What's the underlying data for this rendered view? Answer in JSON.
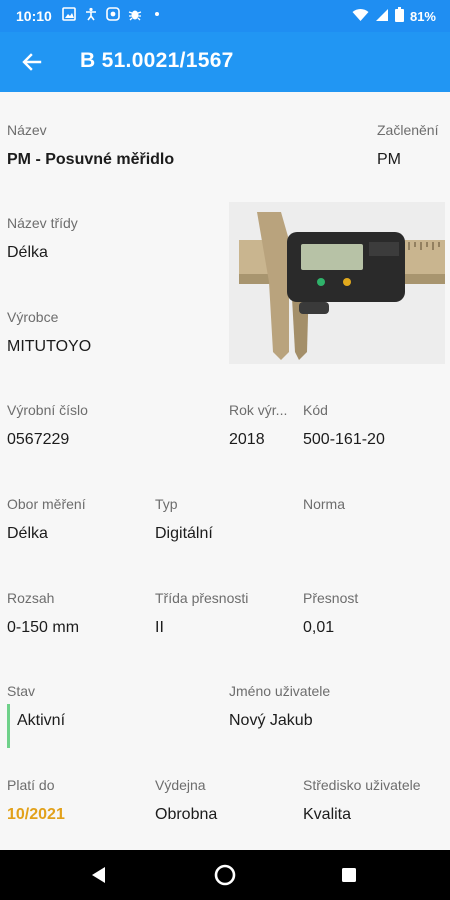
{
  "status": {
    "time": "10:10",
    "battery": "81%",
    "icons": [
      "image-icon",
      "accessibility-icon",
      "app-icon",
      "bug-icon",
      "dot-icon"
    ]
  },
  "appbar": {
    "title": "B 51.0021/1567",
    "back_icon": "arrow-left-icon"
  },
  "fields": {
    "nazev": {
      "label": "Název",
      "value": "PM - Posuvné měřidlo"
    },
    "zacleneni": {
      "label": "Začlenění",
      "value": "PM"
    },
    "nazev_tridy": {
      "label": "Název třídy",
      "value": "Délka"
    },
    "vyrobce": {
      "label": "Výrobce",
      "value": "MITUTOYO"
    },
    "vyrobni_cislo": {
      "label": "Výrobní číslo",
      "value": "0567229"
    },
    "rok_vyroby": {
      "label": "Rok výr...",
      "value": "2018"
    },
    "kod": {
      "label": "Kód",
      "value": "500-161-20"
    },
    "obor_mereni": {
      "label": "Obor měření",
      "value": "Délka"
    },
    "typ": {
      "label": "Typ",
      "value": "Digitální"
    },
    "norma": {
      "label": "Norma",
      "value": ""
    },
    "rozsah": {
      "label": "Rozsah",
      "value": "0-150 mm"
    },
    "trida_presnosti": {
      "label": "Třída přesnosti",
      "value": "II"
    },
    "presnost": {
      "label": "Přesnost",
      "value": "0,01"
    },
    "stav": {
      "label": "Stav",
      "value": "Aktivní"
    },
    "jmeno_uzivatele": {
      "label": "Jméno uživatele",
      "value": "Nový Jakub"
    },
    "plati_do": {
      "label": "Platí do",
      "value": "10/2021"
    },
    "vydejna": {
      "label": "Výdejna",
      "value": "Obrobna"
    },
    "stredisko": {
      "label": "Středisko uživatele",
      "value": "Kvalita"
    }
  },
  "photo": {
    "display_text": "0.00",
    "brand": "Mitutoyo"
  },
  "colors": {
    "appbar": "#2196f3",
    "statusbar": "#1f8ef2",
    "active": "#6fd18a",
    "expiry": "#e2a11a"
  },
  "nav": [
    "back-triangle-icon",
    "home-circle-icon",
    "recents-square-icon"
  ]
}
